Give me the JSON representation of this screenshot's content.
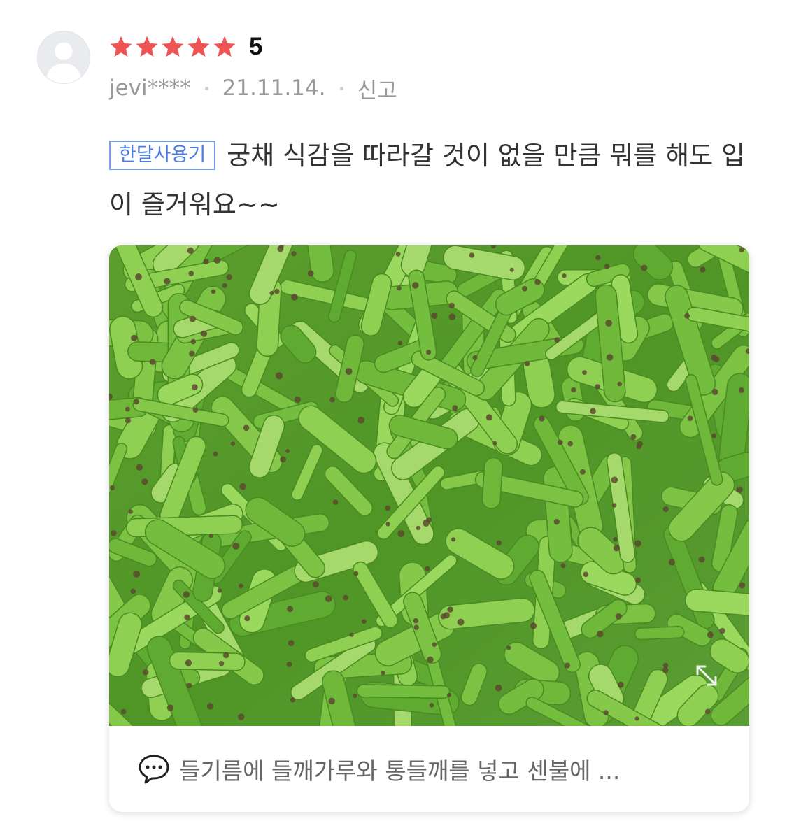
{
  "review": {
    "rating": {
      "stars": 5,
      "max": 5,
      "score_label": "5",
      "star_color": "#ef5454"
    },
    "author": "jevi****",
    "date": "21.11.14.",
    "report_label": "신고",
    "badge": "한달사용기",
    "text": "궁채 식감을 따라갈 것이 없을 만큼 뭐를 해도 입이 즐거워요~~",
    "photo": {
      "alt": "궁채 사진",
      "expand_icon": "expand-icon",
      "caption": "들기름에 들깨가루와 통들깨를 넣고 센불에 ...",
      "caption_icon": "speech-bubble-icon"
    }
  },
  "colors": {
    "badge_border": "#7a9be6",
    "badge_text": "#4b7be5",
    "meta_text": "#999999"
  }
}
